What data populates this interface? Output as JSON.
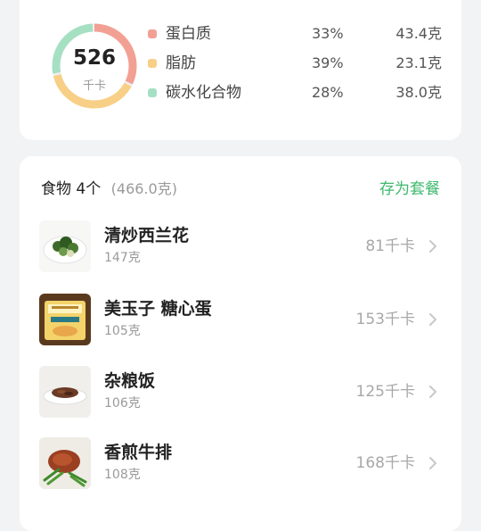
{
  "summary": {
    "calories": "526",
    "calories_unit": "千卡",
    "macros": [
      {
        "name": "蛋白质",
        "percent": "33%",
        "amount": "43.4克",
        "color": "#f2a093",
        "fraction": 0.33
      },
      {
        "name": "脂肪",
        "percent": "39%",
        "amount": "23.1克",
        "color": "#f8cf86",
        "fraction": 0.39
      },
      {
        "name": "碳水化合物",
        "percent": "28%",
        "amount": "38.0克",
        "color": "#a6e0c3",
        "fraction": 0.28
      }
    ]
  },
  "foods": {
    "title": "食物",
    "count": "4个",
    "total_weight": "(466.0克)",
    "save_meal_label": "存为套餐",
    "items": [
      {
        "name": "清炒西兰花",
        "weight": "147克",
        "kcal": "81千卡",
        "thumb": "broccoli"
      },
      {
        "name": "美玉子 糖心蛋",
        "weight": "105克",
        "kcal": "153千卡",
        "thumb": "egg-package"
      },
      {
        "name": "杂粮饭",
        "weight": "106克",
        "kcal": "125千卡",
        "thumb": "rice"
      },
      {
        "name": "香煎牛排",
        "weight": "108克",
        "kcal": "168千卡",
        "thumb": "steak"
      }
    ]
  },
  "colors": {
    "accent_green": "#3cb86b",
    "page_bg": "#f2f3f5"
  }
}
